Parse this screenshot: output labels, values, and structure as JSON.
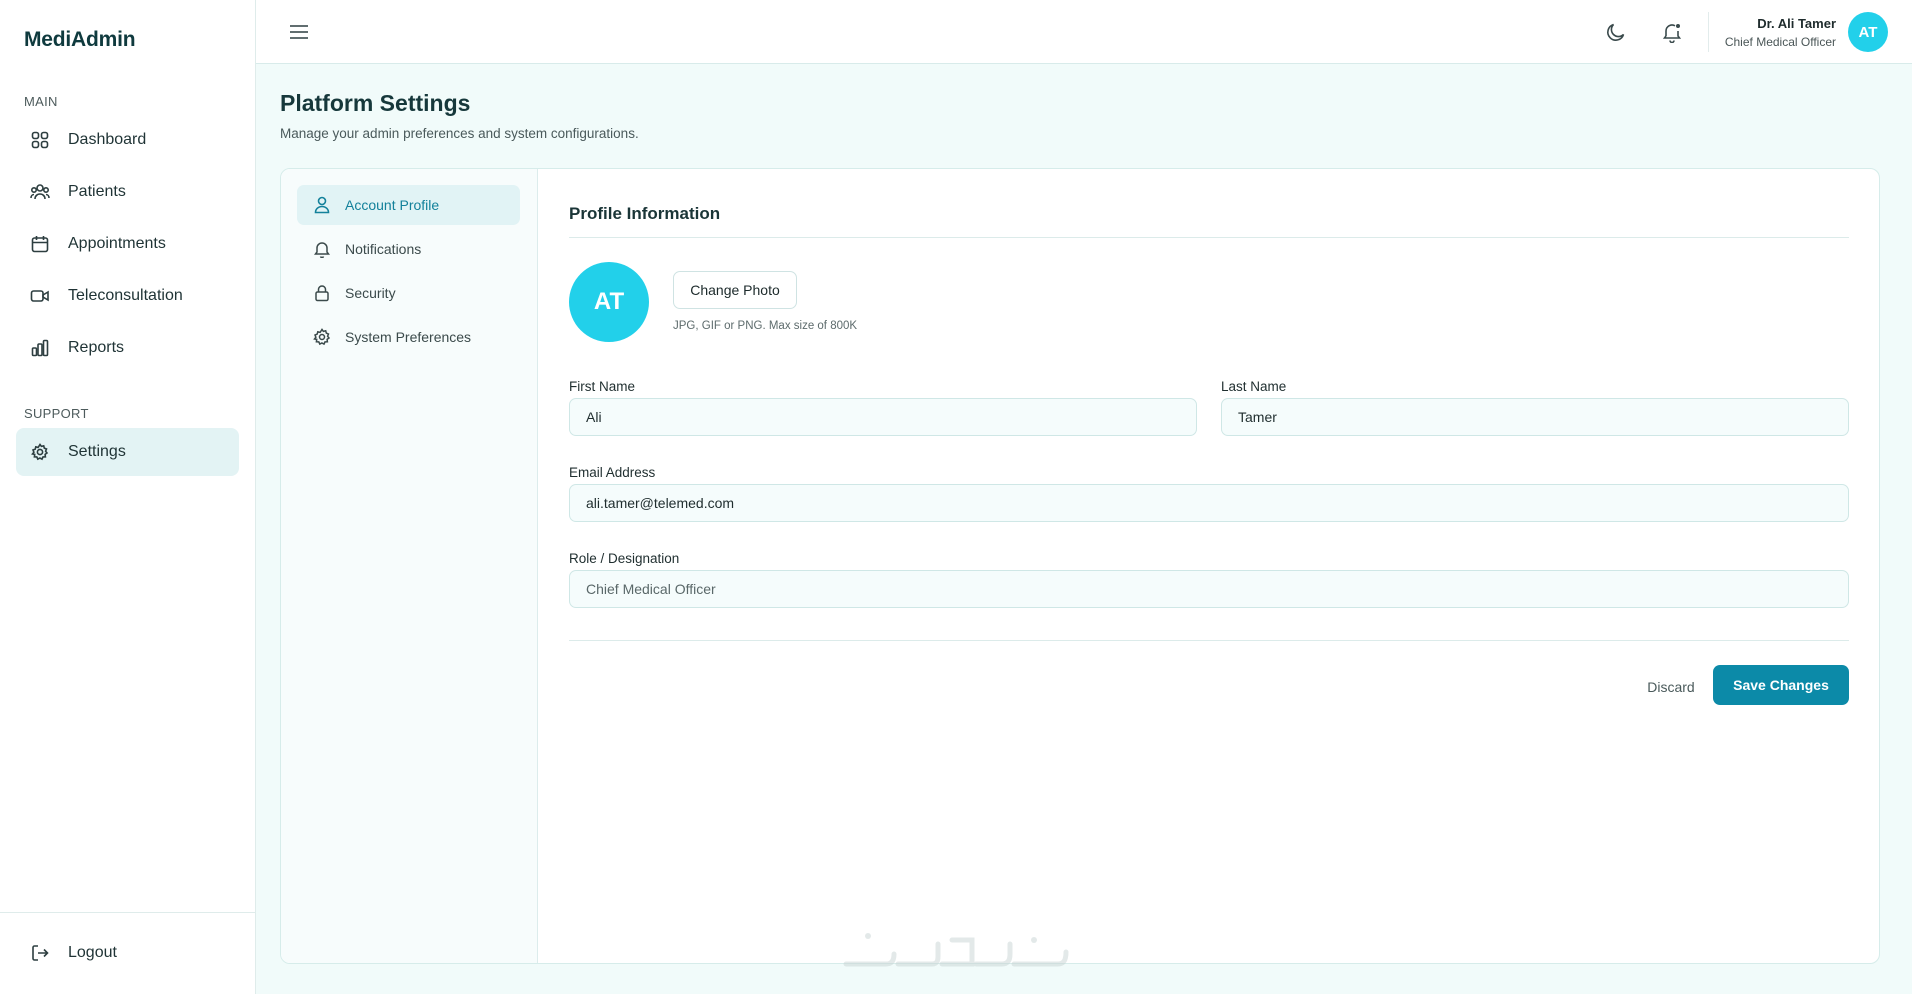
{
  "app": {
    "name": "MediAdmin"
  },
  "sidebar": {
    "main_heading": "MAIN",
    "support_heading": "SUPPORT",
    "items": [
      {
        "label": "Dashboard",
        "icon": "grid-icon"
      },
      {
        "label": "Patients",
        "icon": "users-icon"
      },
      {
        "label": "Appointments",
        "icon": "calendar-icon"
      },
      {
        "label": "Teleconsultation",
        "icon": "video-icon"
      },
      {
        "label": "Reports",
        "icon": "bar-chart-icon"
      }
    ],
    "support_items": [
      {
        "label": "Settings",
        "icon": "gear-icon",
        "active": true
      }
    ],
    "logout_label": "Logout"
  },
  "topbar": {
    "user_name": "Dr. Ali Tamer",
    "user_role": "Chief Medical Officer",
    "avatar_initials": "AT"
  },
  "page": {
    "title": "Platform Settings",
    "subtitle": "Manage your admin preferences and system configurations."
  },
  "settings_nav": [
    {
      "label": "Account Profile",
      "icon": "user-icon",
      "active": true
    },
    {
      "label": "Notifications",
      "icon": "bell-icon"
    },
    {
      "label": "Security",
      "icon": "lock-icon"
    },
    {
      "label": "System Preferences",
      "icon": "gear-icon"
    }
  ],
  "profile": {
    "section_title": "Profile Information",
    "avatar_initials": "AT",
    "change_photo_label": "Change Photo",
    "photo_hint": "JPG, GIF or PNG. Max size of 800K",
    "first_name_label": "First Name",
    "first_name": "Ali",
    "last_name_label": "Last Name",
    "last_name": "Tamer",
    "email_label": "Email Address",
    "email": "ali.tamer@telemed.com",
    "role_label": "Role / Designation",
    "role": "Chief Medical Officer",
    "discard_label": "Discard",
    "save_label": "Save Changes"
  },
  "colors": {
    "accent": "#0c8aa8",
    "avatar": "#22d0ea",
    "active_bg": "#e1f3f5",
    "page_bg": "#f1fbfa"
  }
}
